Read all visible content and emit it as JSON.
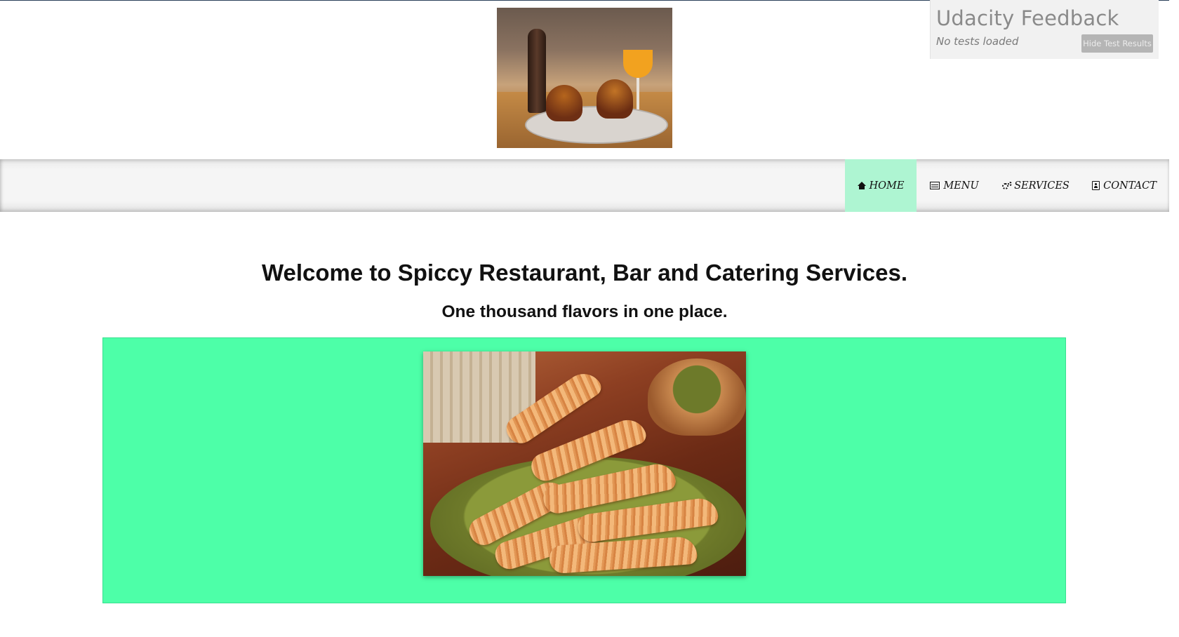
{
  "header": {
    "image_icon": "restaurant-table-photo"
  },
  "feedback_widget": {
    "title": "Udacity Feedback",
    "status": "No tests loaded",
    "hide_button_label": "Hide Test Results"
  },
  "nav": {
    "items": [
      {
        "label": "HOME",
        "icon": "home-icon",
        "active": true
      },
      {
        "label": "MENU",
        "icon": "menu-list-icon",
        "active": false
      },
      {
        "label": "SERVICES",
        "icon": "gears-icon",
        "active": false
      },
      {
        "label": "CONTACT",
        "icon": "contact-card-icon",
        "active": false
      }
    ],
    "active_color": "#aef5d2"
  },
  "main": {
    "welcome": "Welcome to Spiccy Restaurant, Bar and Catering Services.",
    "tagline": "One thousand flavors in one place.",
    "showcase_color": "#4dffa8",
    "showcase_image_icon": "tamales-plate-photo"
  }
}
